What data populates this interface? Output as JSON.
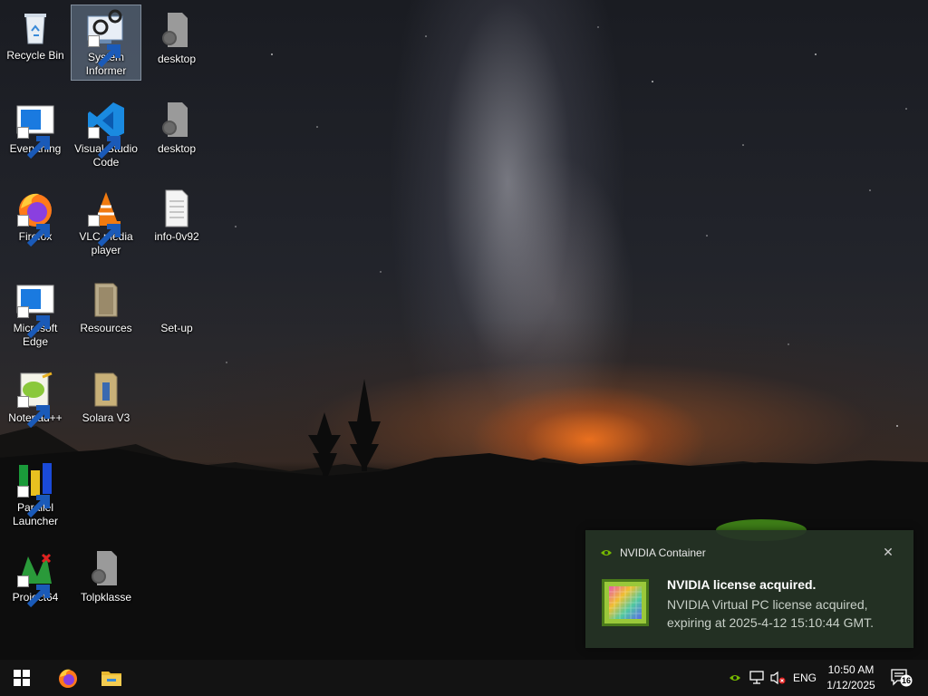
{
  "desktop": {
    "icons": [
      {
        "label": "Recycle Bin",
        "icon": "recycle-bin-icon"
      },
      {
        "label": "System Informer",
        "icon": "system-informer-icon"
      },
      {
        "label": "desktop",
        "icon": "settings-file-icon"
      },
      {
        "label": "Everything",
        "icon": "everything-icon"
      },
      {
        "label": "Visual Studio Code",
        "icon": "vscode-icon"
      },
      {
        "label": "desktop",
        "icon": "settings-file-icon"
      },
      {
        "label": "Firefox",
        "icon": "firefox-icon"
      },
      {
        "label": "VLC media player",
        "icon": "vlc-icon"
      },
      {
        "label": "info-0v92",
        "icon": "text-file-icon"
      },
      {
        "label": "Microsoft Edge",
        "icon": "edge-icon"
      },
      {
        "label": "Resources",
        "icon": "folder-icon"
      },
      {
        "label": "Set-up",
        "icon": "blank-icon"
      },
      {
        "label": "Notepad++",
        "icon": "notepad-plus-plus-icon"
      },
      {
        "label": "Solara V3",
        "icon": "folder-icon"
      },
      {
        "label": "Parallel Launcher",
        "icon": "parallel-launcher-icon"
      },
      {
        "label": "Project64",
        "icon": "project64-icon"
      },
      {
        "label": "Tolpklasse",
        "icon": "settings-file-icon"
      }
    ]
  },
  "notification": {
    "app_name": "NVIDIA Container",
    "title": "NVIDIA license acquired.",
    "body": "NVIDIA Virtual PC license acquired, expiring at 2025-4-12 15:10:44 GMT.",
    "close_icon": "close-icon",
    "accent_color": "#76b900"
  },
  "taskbar": {
    "start_icon": "windows-start-icon",
    "pinned": [
      "firefox-icon",
      "file-explorer-icon"
    ],
    "tray": {
      "icons": [
        "nvidia-tray-icon",
        "network-icon",
        "volume-muted-icon"
      ],
      "language": "ENG",
      "time": "10:50 AM",
      "date": "1/12/2025",
      "notifications_count": "16"
    }
  }
}
